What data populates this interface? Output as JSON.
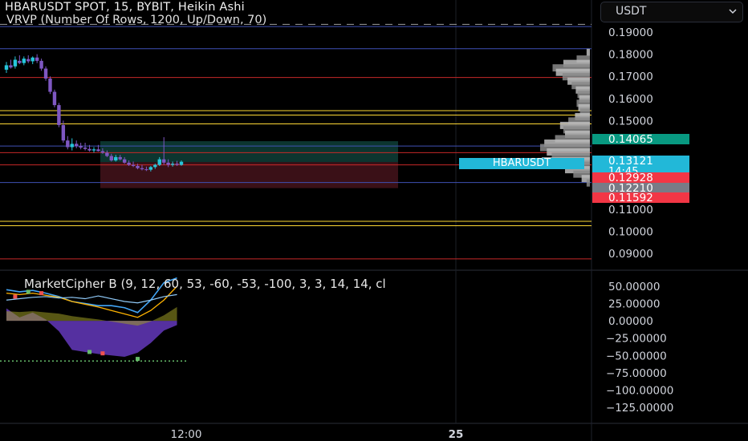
{
  "header": {
    "title": "HBARUSDT SPOT, 15, BYBIT, Heikin Ashi",
    "indicator": "VRVP (Number Of Rows, 1200, Up/Down, 70)",
    "oscillator": "MarketCipher B (9, 12, 60, 53, -60, -53, -100, 3, 3, 14, 14, cl"
  },
  "currency": {
    "label": "USDT"
  },
  "colors": {
    "background": "#000000",
    "bull": "#26c6da",
    "bear": "#7e57c2",
    "cyan_tag": "#22b8d8",
    "green_tag": "#089981",
    "red_tag": "#f23645",
    "gray_tag": "#787b86"
  },
  "chart_data": [
    {
      "type": "candlestick",
      "symbol": "HBARUSDT",
      "price_axis": {
        "ticks": [
          "0.19000",
          "0.18000",
          "0.17000",
          "0.16000",
          "0.15000",
          "0.11000",
          "0.10000",
          "0.09000"
        ],
        "ylim": [
          0.085,
          0.195
        ]
      },
      "time_axis": {
        "ticks": [
          "12:00",
          "25"
        ]
      },
      "price_tags": [
        {
          "value": "0.14065",
          "color": "green"
        },
        {
          "value": "0.13121",
          "sub": "14:45",
          "color": "cyan"
        },
        {
          "value": "0.12928",
          "color": "red"
        },
        {
          "value": "0.12210",
          "color": "gray"
        },
        {
          "value": "0.11592",
          "color": "red"
        }
      ],
      "symbol_tag": "HBARUSDT",
      "horizontal_levels": [
        {
          "price": 0.1925,
          "color": "#3f51b5",
          "style": "solid"
        },
        {
          "price": 0.1935,
          "color": "#9e9e9e",
          "style": "dashed"
        },
        {
          "price": 0.1825,
          "color": "#3f51b5",
          "style": "solid"
        },
        {
          "price": 0.1695,
          "color": "#c62828",
          "style": "solid"
        },
        {
          "price": 0.1545,
          "color": "#fdd835",
          "style": "solid"
        },
        {
          "price": 0.1525,
          "color": "#fdd835",
          "style": "solid"
        },
        {
          "price": 0.1485,
          "color": "#fdd835",
          "style": "solid"
        },
        {
          "price": 0.1385,
          "color": "#3f51b5",
          "style": "solid"
        },
        {
          "price": 0.1355,
          "color": "#c62828",
          "style": "solid"
        },
        {
          "price": 0.13,
          "color": "#c62828",
          "style": "solid"
        },
        {
          "price": 0.122,
          "color": "#3f51b5",
          "style": "solid"
        },
        {
          "price": 0.1045,
          "color": "#fdd835",
          "style": "solid"
        },
        {
          "price": 0.1025,
          "color": "#fdd835",
          "style": "solid"
        },
        {
          "price": 0.0875,
          "color": "#c62828",
          "style": "solid"
        }
      ],
      "position": {
        "entry": 0.1312,
        "target": 0.1407,
        "stop": 0.1195
      },
      "candles": [
        [
          0.173,
          0.1765,
          0.1715,
          0.175
        ],
        [
          0.175,
          0.1775,
          0.1735,
          0.174
        ],
        [
          0.1745,
          0.179,
          0.1735,
          0.1775
        ],
        [
          0.177,
          0.1795,
          0.1755,
          0.176
        ],
        [
          0.176,
          0.179,
          0.175,
          0.178
        ],
        [
          0.1778,
          0.1795,
          0.176,
          0.1768
        ],
        [
          0.1768,
          0.179,
          0.1755,
          0.1785
        ],
        [
          0.1785,
          0.18,
          0.176,
          0.177
        ],
        [
          0.177,
          0.178,
          0.1725,
          0.1735
        ],
        [
          0.1735,
          0.1745,
          0.168,
          0.169
        ],
        [
          0.169,
          0.17,
          0.162,
          0.163
        ],
        [
          0.163,
          0.164,
          0.156,
          0.157
        ],
        [
          0.157,
          0.158,
          0.147,
          0.148
        ],
        [
          0.148,
          0.15,
          0.14,
          0.141
        ],
        [
          0.141,
          0.143,
          0.137,
          0.138
        ],
        [
          0.138,
          0.142,
          0.1365,
          0.1395
        ],
        [
          0.1395,
          0.141,
          0.1375,
          0.1385
        ],
        [
          0.1385,
          0.14,
          0.137,
          0.1378
        ],
        [
          0.1378,
          0.14,
          0.1365,
          0.1372
        ],
        [
          0.1372,
          0.139,
          0.136,
          0.1365
        ],
        [
          0.1365,
          0.138,
          0.1355,
          0.137
        ],
        [
          0.137,
          0.139,
          0.136,
          0.1362
        ],
        [
          0.1362,
          0.1375,
          0.135,
          0.1355
        ],
        [
          0.1355,
          0.1365,
          0.1335,
          0.134
        ],
        [
          0.134,
          0.135,
          0.1315,
          0.132
        ],
        [
          0.132,
          0.1345,
          0.1315,
          0.1335
        ],
        [
          0.1335,
          0.1345,
          0.132,
          0.1325
        ],
        [
          0.1325,
          0.1335,
          0.1305,
          0.131
        ],
        [
          0.131,
          0.132,
          0.1295,
          0.13
        ],
        [
          0.13,
          0.1315,
          0.129,
          0.1295
        ],
        [
          0.1295,
          0.1305,
          0.128,
          0.1285
        ],
        [
          0.1285,
          0.13,
          0.1275,
          0.128
        ],
        [
          0.128,
          0.1292,
          0.1272,
          0.1278
        ],
        [
          0.1278,
          0.1295,
          0.127,
          0.129
        ],
        [
          0.129,
          0.1305,
          0.1282,
          0.13
        ],
        [
          0.13,
          0.1335,
          0.1295,
          0.1325
        ],
        [
          0.1325,
          0.1425,
          0.13,
          0.131
        ],
        [
          0.131,
          0.1325,
          0.129,
          0.13
        ],
        [
          0.13,
          0.1315,
          0.1292,
          0.1305
        ],
        [
          0.1305,
          0.1318,
          0.1295,
          0.13
        ],
        [
          0.13,
          0.132,
          0.1296,
          0.1314
        ]
      ],
      "volume_profile": [
        [
          0.181,
          0.4
        ],
        [
          0.178,
          1.6
        ],
        [
          0.176,
          3.2
        ],
        [
          0.174,
          4.5
        ],
        [
          0.172,
          4.1
        ],
        [
          0.17,
          3.3
        ],
        [
          0.168,
          2.7
        ],
        [
          0.166,
          2.2
        ],
        [
          0.164,
          1.7
        ],
        [
          0.162,
          1.5
        ],
        [
          0.16,
          1.3
        ],
        [
          0.158,
          1.6
        ],
        [
          0.156,
          1.4
        ],
        [
          0.154,
          1.2
        ],
        [
          0.152,
          1.8
        ],
        [
          0.15,
          2.6
        ],
        [
          0.148,
          3.6
        ],
        [
          0.146,
          3.2
        ],
        [
          0.144,
          3.0
        ],
        [
          0.142,
          4.2
        ],
        [
          0.14,
          5.5
        ],
        [
          0.138,
          6.0
        ],
        [
          0.136,
          5.2
        ],
        [
          0.134,
          4.6
        ],
        [
          0.132,
          5.8
        ],
        [
          0.13,
          4.4
        ],
        [
          0.128,
          3.0
        ],
        [
          0.126,
          2.0
        ],
        [
          0.124,
          1.0
        ],
        [
          0.122,
          0.4
        ]
      ]
    },
    {
      "type": "line",
      "name": "MarketCipher B",
      "y_axis": {
        "ticks": [
          "50.00000",
          "25.00000",
          "0.00000",
          "−25.00000",
          "−50.00000",
          "−75.00000",
          "−100.00000",
          "−125.00000"
        ],
        "ylim": [
          -137,
          62
        ]
      },
      "x_index": [
        0,
        3,
        6,
        9,
        12,
        15,
        18,
        21,
        24,
        27,
        30,
        33,
        36,
        39
      ],
      "money_flow": [
        18,
        5,
        12,
        2,
        -15,
        -42,
        -45,
        -48,
        -50,
        -52,
        -46,
        -32,
        -14,
        -6
      ],
      "wave1": [
        45,
        42,
        44,
        40,
        35,
        28,
        25,
        22,
        22,
        19,
        12,
        30,
        55,
        62
      ],
      "wave2": [
        40,
        38,
        40,
        37,
        34,
        28,
        24,
        20,
        15,
        10,
        5,
        15,
        30,
        50
      ],
      "rsi_line": [
        30,
        32,
        34,
        35,
        33,
        34,
        32,
        36,
        32,
        28,
        26,
        30,
        35,
        38
      ],
      "dots": [
        {
          "i": 2,
          "v": 35,
          "color": "#ef5350"
        },
        {
          "i": 5,
          "v": 42,
          "color": "#66bb6a"
        },
        {
          "i": 8,
          "v": 40,
          "color": "#ef5350"
        },
        {
          "i": 19,
          "v": -45,
          "color": "#66bb6a"
        },
        {
          "i": 22,
          "v": -47,
          "color": "#ef5350"
        },
        {
          "i": 30,
          "v": -55,
          "color": "#66bb6a"
        }
      ],
      "baseline": -58
    }
  ]
}
